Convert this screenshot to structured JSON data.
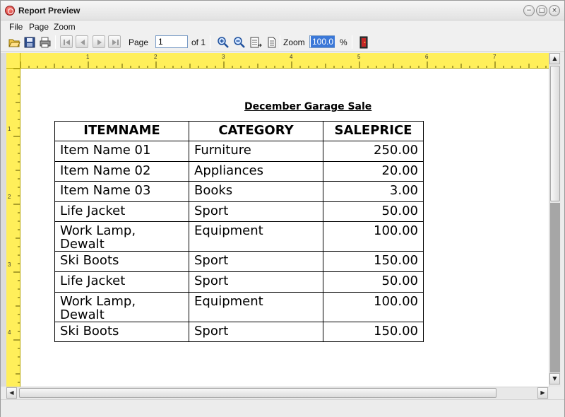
{
  "window": {
    "title": "Report Preview",
    "controls": {
      "minimize": "−",
      "maximize": "□",
      "close": "×"
    }
  },
  "menu": {
    "items": [
      "File",
      "Page",
      "Zoom"
    ]
  },
  "toolbar": {
    "page_label": "Page",
    "page_value": "1",
    "of_label": "of 1",
    "zoom_label": "Zoom",
    "zoom_value": "100.0",
    "percent_label": "%",
    "icons": [
      "open-folder-icon",
      "save-icon",
      "print-icon",
      "first-page-icon",
      "previous-page-icon",
      "next-page-icon",
      "last-page-icon",
      "zoom-in-icon",
      "zoom-out-icon",
      "page-width-icon",
      "whole-page-icon",
      "exit-icon"
    ]
  },
  "rulers": {
    "horizontal_labels": [
      "1",
      "2",
      "3",
      "4",
      "5",
      "6",
      "7"
    ],
    "vertical_labels": [
      "1",
      "2",
      "3",
      "4"
    ],
    "color": "#ffef5a"
  },
  "report": {
    "title": "December Garage Sale",
    "columns": [
      "ITEMNAME",
      "CATEGORY",
      "SALEPRICE"
    ],
    "rows": [
      [
        "Item Name 01",
        "Furniture",
        "250.00"
      ],
      [
        "Item Name 02",
        "Appliances",
        "20.00"
      ],
      [
        "Item Name 03",
        "Books",
        "3.00"
      ],
      [
        "Life Jacket",
        "Sport",
        "50.00"
      ],
      [
        "Work Lamp,\nDewalt",
        "Equipment",
        "100.00"
      ],
      [
        "Ski Boots",
        "Sport",
        "150.00"
      ],
      [
        "Life Jacket",
        "Sport",
        "50.00"
      ],
      [
        "Work Lamp,\nDewalt",
        "Equipment",
        "100.00"
      ],
      [
        "Ski Boots",
        "Sport",
        "150.00"
      ]
    ]
  },
  "scrollbars": {
    "up": "▲",
    "down": "▼",
    "left": "◀",
    "right": "▶"
  }
}
